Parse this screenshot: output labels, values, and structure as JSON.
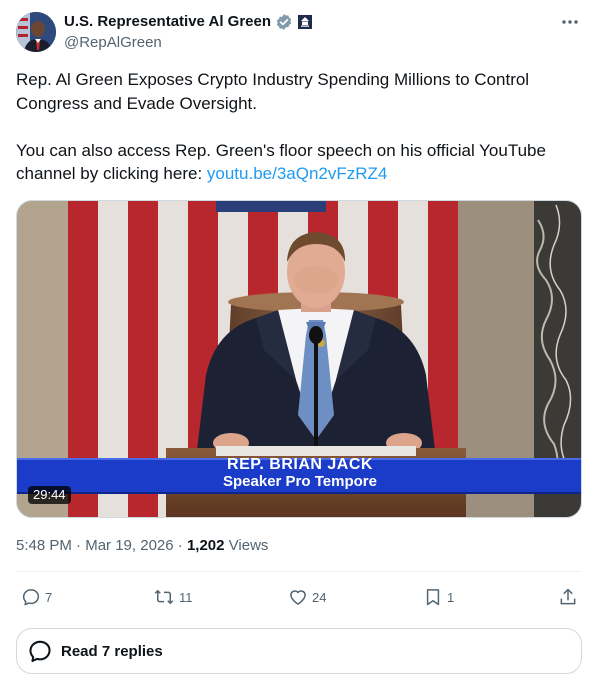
{
  "author": {
    "display_name": "U.S. Representative Al Green",
    "handle": "@RepAlGreen",
    "verified_icon": "verified-gray-badge-icon",
    "affiliation_icon": "government-seal-icon"
  },
  "post": {
    "text_line1": "Rep. Al Green Exposes Crypto Industry Spending Millions to Control Congress and Evade Oversight.",
    "text_line2": "You can also access Rep. Green's floor speech on his official YouTube channel by clicking here: ",
    "link_text": "youtu.be/3aQn2vFzRZ4"
  },
  "video": {
    "duration": "29:44",
    "chyron_name": "REP. BRIAN JACK",
    "chyron_title": "Speaker Pro Tempore"
  },
  "meta": {
    "time": "5:48 PM",
    "sep1": " · ",
    "date": "Mar 19, 2026",
    "sep2": " · ",
    "views_count": "1,202",
    "views_label": " Views"
  },
  "actions": {
    "replies": "7",
    "reposts": "11",
    "likes": "24",
    "bookmarks": "1"
  },
  "read_replies": {
    "label": "Read 7 replies"
  },
  "colors": {
    "link": "#1d9bf0",
    "secondary_text": "#536471",
    "primary_text": "#0f1419",
    "border": "#cfd9de",
    "chyron_blue": "#1a3cc8"
  }
}
